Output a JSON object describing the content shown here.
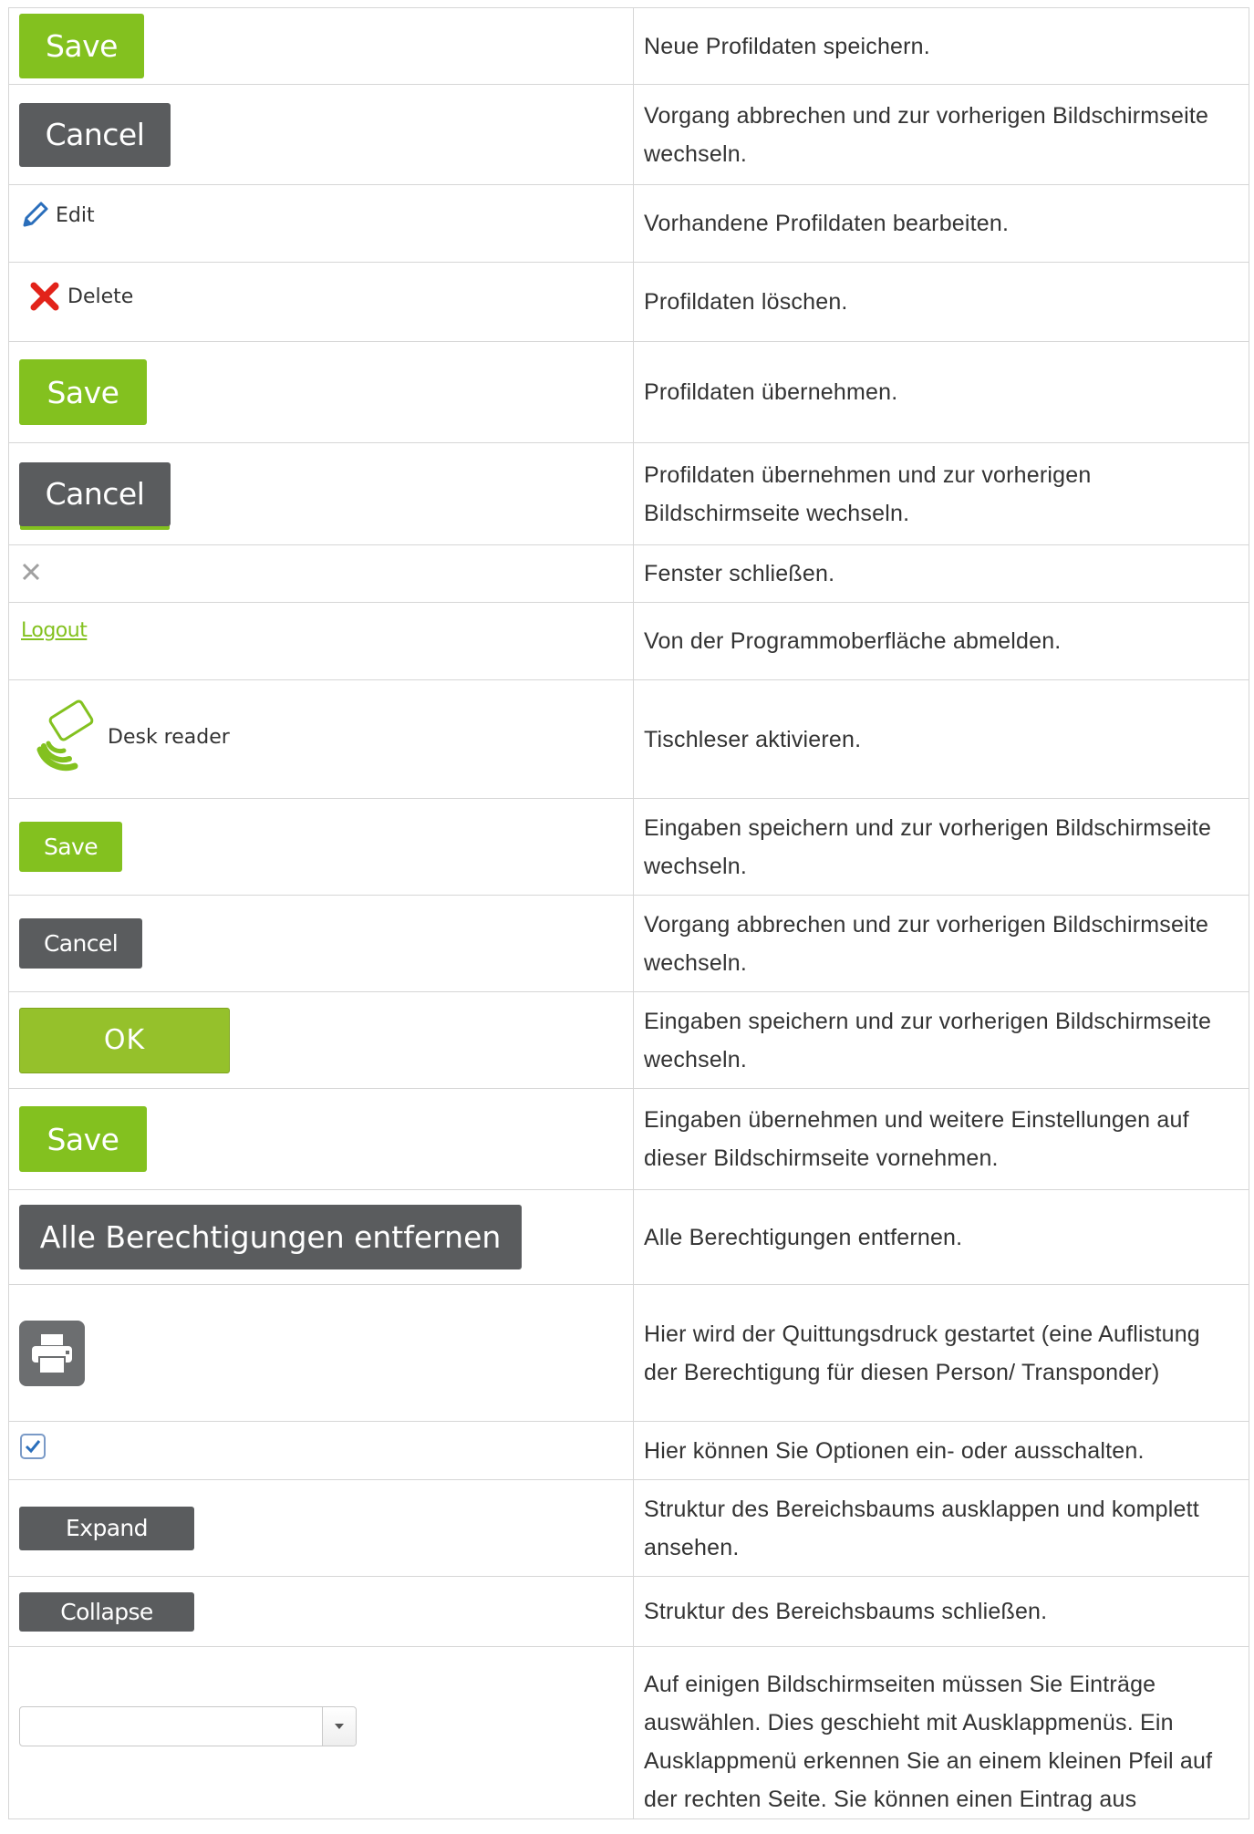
{
  "rows": [
    {
      "control": "Save",
      "desc": "Neue Profildaten speichern."
    },
    {
      "control": "Cancel",
      "desc": "Vorgang abbrechen und zur vorherigen Bildschirmseite wechseln."
    },
    {
      "control": "Edit",
      "desc": "Vorhandene Profildaten bearbeiten."
    },
    {
      "control": "Delete",
      "desc": "Profildaten löschen."
    },
    {
      "control": "Save",
      "desc": "Profildaten übernehmen."
    },
    {
      "control": "Cancel",
      "desc": "Profildaten übernehmen und zur vorherigen Bildschirmseite wechseln."
    },
    {
      "control": "",
      "desc": "Fenster schließen."
    },
    {
      "control": "Logout",
      "desc": "Von der Programmoberfläche abmelden."
    },
    {
      "control": "Desk reader",
      "desc": "Tischleser aktivieren."
    },
    {
      "control": "Save",
      "desc": "Eingaben speichern und zur vorherigen Bildschirmseite wechseln."
    },
    {
      "control": "Cancel",
      "desc": "Vorgang abbrechen und zur vorherigen Bildschirmseite wechseln."
    },
    {
      "control": "OK",
      "desc": "Eingaben speichern und zur vorherigen Bildschirmseite wechseln."
    },
    {
      "control": "Save",
      "desc": "Eingaben übernehmen und weitere Einstellungen auf dieser Bildschirmseite vornehmen."
    },
    {
      "control": "Alle Berechtigungen entfernen",
      "desc": "Alle Berechtigungen entfernen."
    },
    {
      "control": "",
      "desc": "Hier wird der Quittungsdruck gestartet (eine Auflistung der Berechtigung für diesen Person/ Transponder)"
    },
    {
      "control": "",
      "desc": "Hier können Sie Optionen ein- oder ausschalten."
    },
    {
      "control": "Expand",
      "desc": "Struktur des Bereichsbaums ausklappen und komplett ansehen."
    },
    {
      "control": "Collapse",
      "desc": "Struktur des Bereichsbaums schließen."
    },
    {
      "control": "",
      "desc": "Auf einigen Bildschirmseiten müssen Sie Einträge auswählen. Dies geschieht mit Ausklappmenüs. Ein Ausklappmenü erkennen Sie an einem kleinen Pfeil auf der rechten Seite. Sie können einen Eintrag aus"
    }
  ],
  "colors": {
    "green": "#83c11f",
    "gray": "#5a5c5e",
    "delete_red": "#e2231a",
    "edit_blue": "#2a6ebb",
    "print_gray": "#6c6e70"
  },
  "icons": [
    "pencil-icon",
    "x-mark-icon",
    "close-icon",
    "desk-reader-icon",
    "printer-icon",
    "checkbox-checked-icon",
    "dropdown-arrow-icon"
  ]
}
